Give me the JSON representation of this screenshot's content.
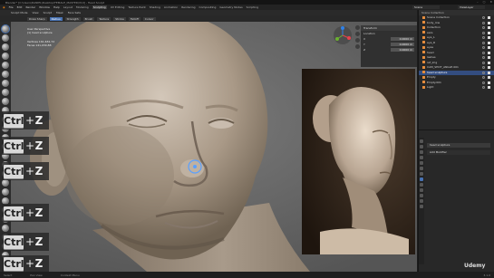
{
  "window": {
    "title": "Blender* [C:\\Users\\DANIEL\\Desktop\\FEMALE_MASTER\\V10] - Head Sculpt",
    "controls": [
      "–",
      "▢",
      "✕"
    ]
  },
  "menubar": {
    "items": [
      "File",
      "Edit",
      "Render",
      "Window",
      "Help"
    ],
    "workspaces": [
      "Layout",
      "Modeling",
      "Sculpting",
      "UV Editing",
      "Texture Paint",
      "Shading",
      "Animation",
      "Rendering",
      "Compositing",
      "Geometry Nodes",
      "Scripting"
    ],
    "active_workspace": "Sculpting",
    "scene_name": "Scene",
    "view_layer": "ViewLayer"
  },
  "topbar": {
    "items": [
      "Sculpt Mode",
      "View",
      "Sculpt",
      "Mask",
      "Face Sets"
    ]
  },
  "toolbar": {
    "chips": [
      "Draw Sharp",
      "Radius",
      "Strength",
      "Brush",
      "Texture",
      "Stroke",
      "Falloff",
      "Cursor"
    ]
  },
  "viewport": {
    "info_lines": [
      "User Perspective",
      "(1) head sculpture"
    ],
    "stats": [
      "Vertices   161,632,72",
      "Faces       141,030,88"
    ]
  },
  "npanel": {
    "header": "Transform",
    "rows": [
      {
        "label": "Location",
        "value": ""
      },
      {
        "label": "X",
        "value": "0.0000 m"
      },
      {
        "label": "Y",
        "value": "0.0000 m"
      },
      {
        "label": "Z",
        "value": "0.0000 m"
      }
    ]
  },
  "outliner": {
    "header": "Scene Collection",
    "rows": [
      {
        "label": "Scene Collection",
        "selected": false
      },
      {
        "label": "body_low",
        "selected": false
      },
      {
        "label": "Collection",
        "selected": false
      },
      {
        "label": "ears",
        "selected": false
      },
      {
        "label": "eye_L",
        "selected": false
      },
      {
        "label": "eye_R",
        "selected": false
      },
      {
        "label": "eyes",
        "selected": false
      },
      {
        "label": "head",
        "selected": false
      },
      {
        "label": "lashes",
        "selected": false
      },
      {
        "label": "ref_img",
        "selected": false
      },
      {
        "label": "CAM_SHOT_ANGLE.001",
        "selected": false
      },
      {
        "label": "head sculpture",
        "selected": true
      },
      {
        "label": "Empty",
        "selected": false
      },
      {
        "label": "Empty.001",
        "selected": false
      },
      {
        "label": "Light",
        "selected": false
      }
    ]
  },
  "properties": {
    "object_name": "head sculpture",
    "section": "Add Modifier"
  },
  "keycaps": [
    {
      "key": "Ctrl",
      "plus": "+",
      "letter": "Z"
    },
    {
      "key": "Ctrl",
      "plus": "+",
      "letter": "Z"
    },
    {
      "key": "Ctrl",
      "plus": "+",
      "letter": "Z"
    },
    {
      "key": "Ctrl",
      "plus": "+",
      "letter": "Z"
    },
    {
      "key": "Ctrl",
      "plus": "+",
      "letter": "Z"
    },
    {
      "key": "Ctrl",
      "plus": "+",
      "letter": "Z"
    }
  ],
  "statusbar": {
    "items": [
      "Select",
      "Pan View",
      "Context Menu"
    ],
    "version": "3.1.0"
  },
  "watermark": "Udemy",
  "colors": {
    "accent": "#4772b3",
    "viewport_bg": "#6c6c6c",
    "clay": "#b8a99a",
    "outliner_selected": "#334d80"
  }
}
